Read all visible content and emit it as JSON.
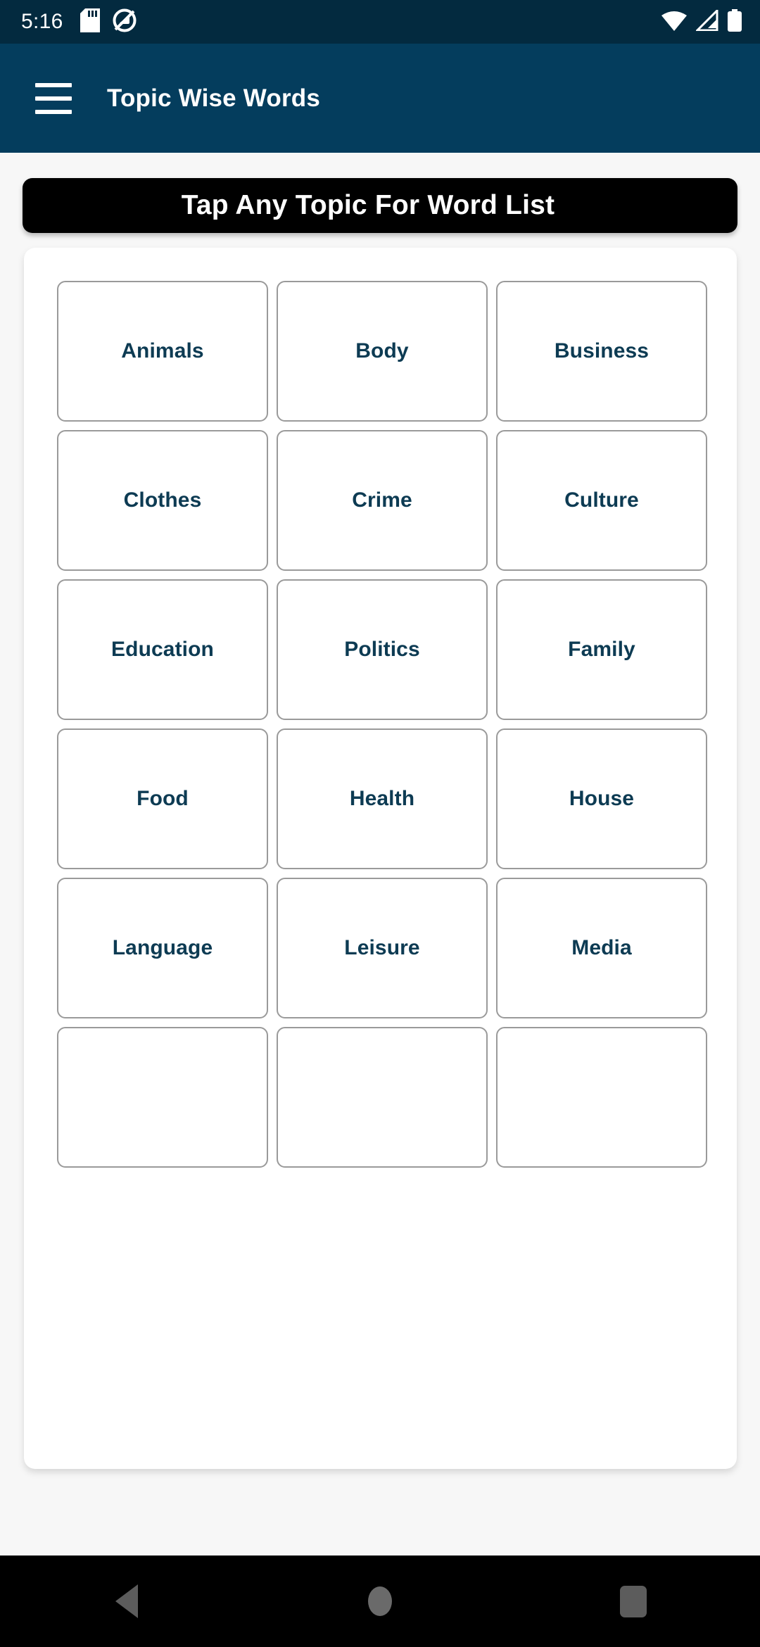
{
  "status_bar": {
    "clock": "5:16",
    "left_icons": [
      "sd-card-icon",
      "mute-icon"
    ],
    "right_icons": [
      "wifi-icon",
      "cellular-signal-icon",
      "battery-icon"
    ],
    "background_color": "#032a3f"
  },
  "app_bar": {
    "menu_icon": "hamburger-menu-icon",
    "title": "Topic Wise Words",
    "background_color": "#043d5d",
    "title_color": "#ffffff"
  },
  "banner": {
    "text": "Tap Any Topic For Word List",
    "background_color": "#000000",
    "text_color": "#ffffff"
  },
  "grid": {
    "columns": 3,
    "card_text_color": "#0d3b53",
    "card_border_color": "#9a9a9a",
    "topics": [
      {
        "label": "Animals"
      },
      {
        "label": "Body"
      },
      {
        "label": "Business"
      },
      {
        "label": "Clothes"
      },
      {
        "label": "Crime"
      },
      {
        "label": "Culture"
      },
      {
        "label": "Education"
      },
      {
        "label": "Politics"
      },
      {
        "label": "Family"
      },
      {
        "label": "Food"
      },
      {
        "label": "Health"
      },
      {
        "label": "House"
      },
      {
        "label": "Language"
      },
      {
        "label": "Leisure"
      },
      {
        "label": "Media"
      },
      {
        "label": ""
      },
      {
        "label": ""
      },
      {
        "label": ""
      }
    ]
  },
  "nav_bar": {
    "background_color": "#000000",
    "buttons": [
      {
        "name": "back-button",
        "icon": "triangle-left-icon"
      },
      {
        "name": "home-button",
        "icon": "circle-icon"
      },
      {
        "name": "recents-button",
        "icon": "square-icon"
      }
    ]
  }
}
